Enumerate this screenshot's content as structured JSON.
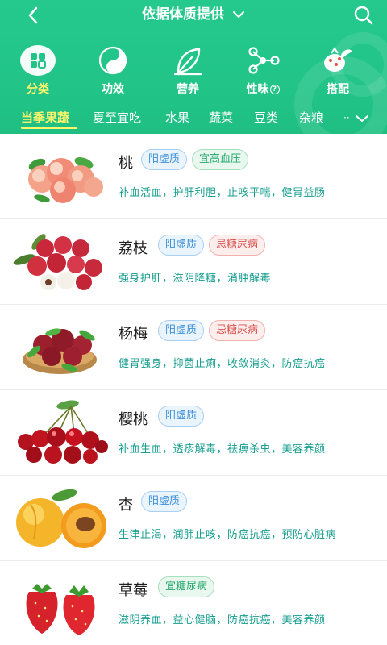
{
  "header": {
    "title": "依据体质提供",
    "back_icon": "chevron-left-icon",
    "search_icon": "search-icon"
  },
  "categories": [
    {
      "label": "分类",
      "icon": "grid-icon",
      "active": true
    },
    {
      "label": "功效",
      "icon": "yin-yang-icon",
      "active": false
    },
    {
      "label": "营养",
      "icon": "leaf-icon",
      "active": false
    },
    {
      "label": "性味",
      "icon": "molecule-icon",
      "active": false,
      "badge": "?"
    },
    {
      "label": "搭配",
      "icon": "vegetables-icon",
      "active": false
    }
  ],
  "subtabs": {
    "items": [
      "当季果蔬",
      "夏至宜吃",
      "水果",
      "蔬菜",
      "豆类",
      "杂粮"
    ],
    "active_index": 0,
    "more_dots": "··",
    "expand_icon": "chevron-down-icon"
  },
  "foods": [
    {
      "name": "桃",
      "image": "peach-image",
      "tags": [
        {
          "text": "阳虚质",
          "kind": "blue"
        },
        {
          "text": "宜高血压",
          "kind": "green"
        }
      ],
      "effects": "补血活血，护肝利胆，止咳平喘，健胃益肠"
    },
    {
      "name": "荔枝",
      "image": "lychee-image",
      "tags": [
        {
          "text": "阳虚质",
          "kind": "blue"
        },
        {
          "text": "忌糖尿病",
          "kind": "red"
        }
      ],
      "effects": "强身护肝，滋阴降糖，消肿解毒"
    },
    {
      "name": "杨梅",
      "image": "bayberry-image",
      "tags": [
        {
          "text": "阳虚质",
          "kind": "blue"
        },
        {
          "text": "忌糖尿病",
          "kind": "red"
        }
      ],
      "effects": "健胃强身，抑菌止痢，收敛消炎，防癌抗癌"
    },
    {
      "name": "樱桃",
      "image": "cherry-image",
      "tags": [
        {
          "text": "阳虚质",
          "kind": "blue"
        }
      ],
      "effects": "补血生血，透疹解毒，祛痹杀虫，美容养颜"
    },
    {
      "name": "杏",
      "image": "apricot-image",
      "tags": [
        {
          "text": "阳虚质",
          "kind": "blue"
        }
      ],
      "effects": "生津止渴，润肺止咳，防癌抗癌，预防心脏病"
    },
    {
      "name": "草莓",
      "image": "strawberry-image",
      "tags": [
        {
          "text": "宜糖尿病",
          "kind": "green"
        }
      ],
      "effects": "滋阴养血，益心健脑，防癌抗癌，美容养颜"
    }
  ],
  "colors": {
    "header_green": "#22c488",
    "active_yellow": "#fff56b",
    "effect_text": "#169e8f"
  }
}
